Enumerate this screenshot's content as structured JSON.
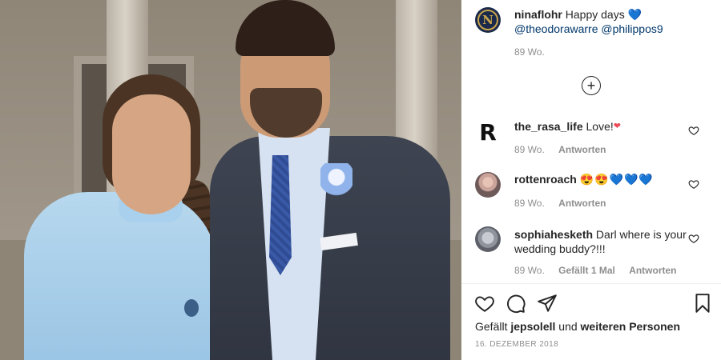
{
  "post": {
    "author": "ninaflohr",
    "caption_text": "Happy days",
    "caption_emoji": "💙",
    "mentions": [
      "@theodorawarre",
      "@philippos9"
    ],
    "time": "89 Wo.",
    "avatar_letter": "N"
  },
  "comments": [
    {
      "username": "the_rasa_life",
      "text": "Love!",
      "emoji": "❤",
      "time": "89 Wo.",
      "reply": "Antworten",
      "avatar_letter": "R"
    },
    {
      "username": "rottenroach",
      "text": "",
      "emoji": "😍😍💙💙💙",
      "time": "89 Wo.",
      "reply": "Antworten"
    },
    {
      "username": "sophiahesketh",
      "text": "Darl where is your wedding buddy?!!!",
      "time": "89 Wo.",
      "likes": "Gefällt 1 Mal",
      "reply": "Antworten"
    }
  ],
  "footer": {
    "likes_prefix": "Gefällt",
    "likes_user": "jepsolell",
    "likes_middle": "und",
    "likes_others": "weiteren Personen",
    "date": "16. DEZEMBER 2018"
  },
  "icons": {
    "load_more": "plus-circle-icon",
    "like": "heart-icon",
    "comment": "comment-icon",
    "share": "send-icon",
    "save": "bookmark-icon"
  },
  "colors": {
    "mention": "#00376b",
    "meta": "#8e8e8e",
    "text": "#262626"
  }
}
